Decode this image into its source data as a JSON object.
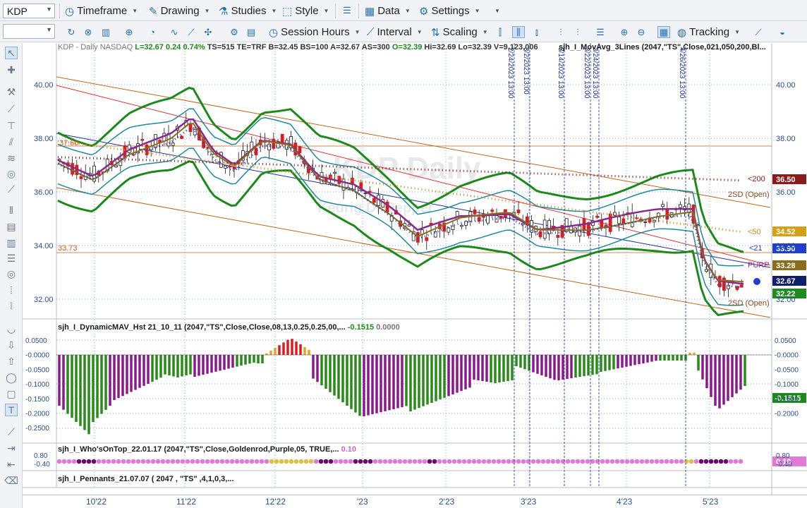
{
  "toolbar1": {
    "symbol": "KDP",
    "items": [
      "Timeframe",
      "Drawing",
      "Studies",
      "Style",
      "Data",
      "Settings"
    ]
  },
  "toolbar2": {
    "session": "Session Hours",
    "interval": "Interval",
    "scaling": "Scaling",
    "tracking": "Tracking"
  },
  "header": {
    "symbol_desc": "KDP - Daily  NASDAQ",
    "L": "L=32.67",
    "chg": "0.24",
    "pct": "0.74%",
    "rest": "TS=515  TE=TRF  B=32.45  BS=100  A=32.67  AS=300",
    "O": "O=32.39",
    "tail": "Hi=32.69  Lo=32.39  V=9,123,006",
    "study": "sjh_I_MovAvg_3Lines (2047,\"TS\",Close,021,050,200,Bl..."
  },
  "watermark": {
    "big": "KDP Daily",
    "small": "Keurig Dr Pepper"
  },
  "price_axis": [
    "40.00",
    "38.00",
    "36.00",
    "34.00",
    "32.00"
  ],
  "price_tags": [
    {
      "label": "36.50",
      "color": "#8b1a1a"
    },
    {
      "label": "34.52",
      "color": "#d4a017"
    },
    {
      "label": "33.90",
      "color": "#1f3fd1"
    },
    {
      "label": "33.28",
      "color": "#8a6d1a"
    },
    {
      "label": "32.67",
      "color": "#0f1f6b"
    },
    {
      "label": "32.22",
      "color": "#1f8a1f"
    }
  ],
  "line_labels": {
    "ma200": "<200",
    "ma50": "<50",
    "ma21": "<21",
    "purp": "PURP",
    "sd_top": "2SD (Open)",
    "sd_bot": "2SD (Open)",
    "left_val": "33.73",
    "left_val2": "37.60"
  },
  "event_lines": [
    "2/24/2023 13:00",
    "3/2/2023 13:00",
    "3/14/2023 13:00",
    "3/22/2023 13:00",
    "3/24/2023 13:00",
    "4/26/2023 13:00"
  ],
  "panel2": {
    "title": "sjh_I_DynamicMAV_Hst 21_10_11 (2047,\"TS\",Close,Close,08,13,0.25,0.25,00,...",
    "v1": "-0.1515",
    "v2": "0.0000",
    "axis": [
      "0.0500",
      "-0.0000",
      "-0.0500",
      "-0.1000",
      "-0.1500",
      "-0.2000",
      "-0.2500"
    ],
    "right_axis": [
      "0.0500",
      "-0.0000",
      "-0.0500",
      "-0.1000",
      "-0.1500",
      "-0.2000"
    ],
    "tag": "-0.1515"
  },
  "panel3": {
    "title": "sjh_I_Who'sOnTop_22.01.17 (2047,\"TS\",Close,Goldenrod,Purple,05, TRUE,...",
    "v1": "0.10",
    "axis": [
      "0.80",
      "-0.40"
    ],
    "right_axis": [
      "0.80",
      "-0.40"
    ],
    "tag": "0.10"
  },
  "panel4": {
    "title": "sjh_I_Pennants_21.07.07 ( 2047 , \"TS\" ,4,1,0,3,..."
  },
  "time_axis": [
    "10'22",
    "11'22",
    "12'22",
    "'23",
    "2'23",
    "3'23",
    "4'23",
    "5'23"
  ]
}
